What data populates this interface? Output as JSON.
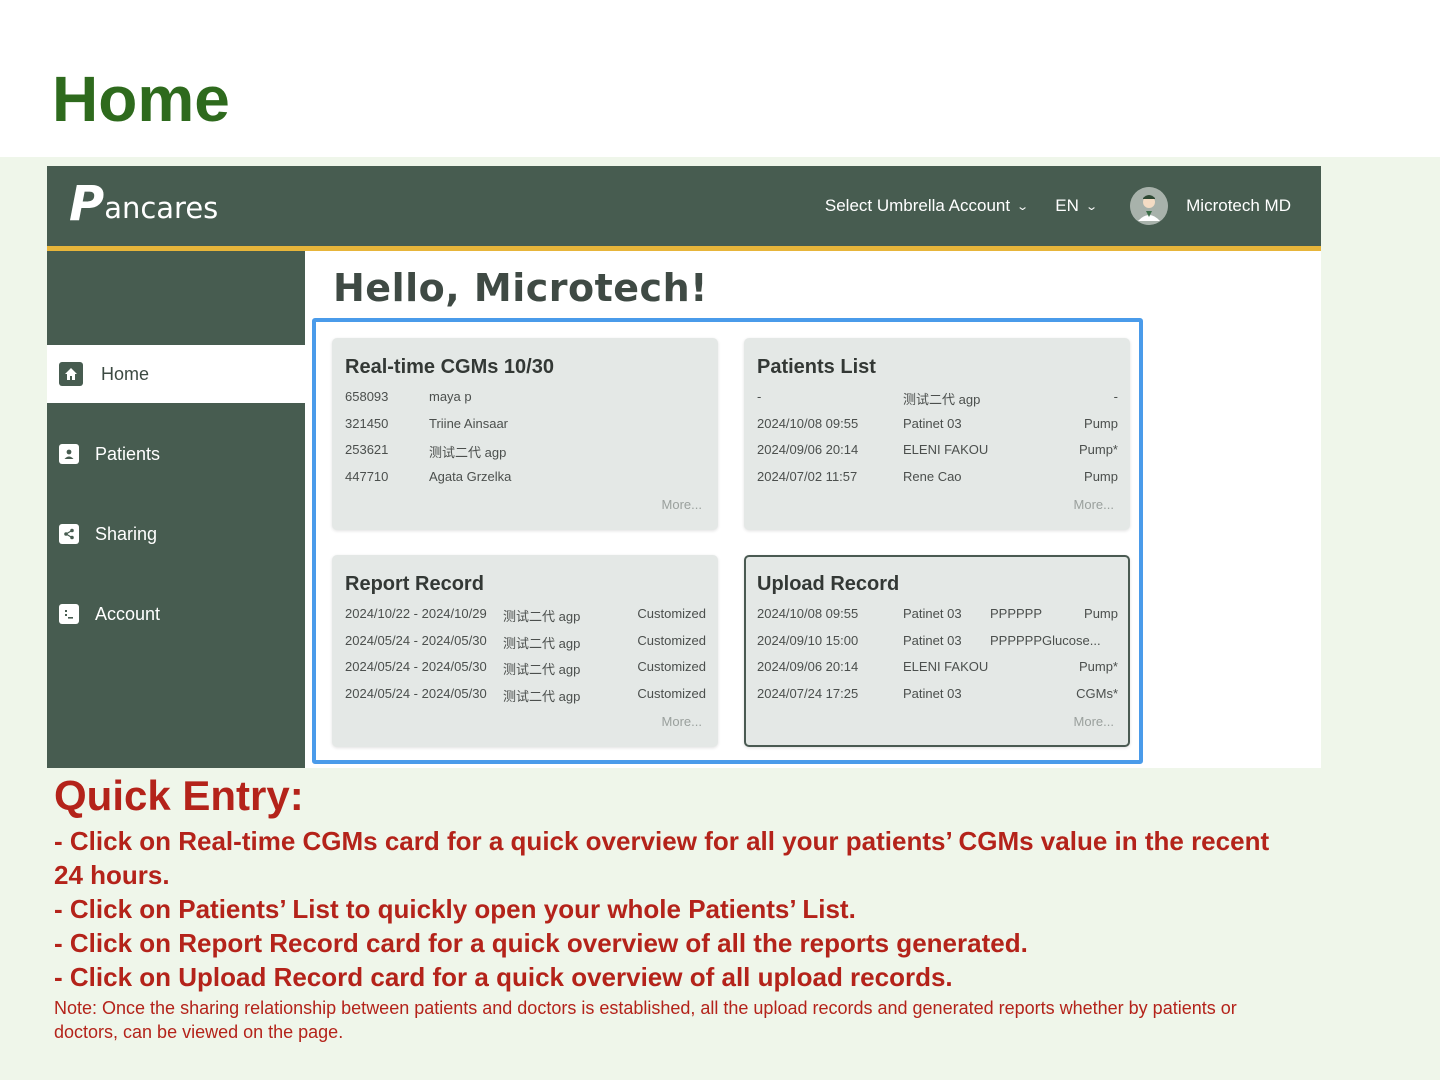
{
  "slide": {
    "title": "Home"
  },
  "app": {
    "logo_p": "P",
    "logo_rest": "ancares",
    "umbrella_label": "Select Umbrella Account",
    "language": "EN",
    "user_name": "Microtech MD",
    "greeting": "Hello, Microtech!",
    "sidebar": [
      {
        "label": "Home",
        "icon": "home-icon",
        "active": true
      },
      {
        "label": "Patients",
        "icon": "patient-icon",
        "active": false
      },
      {
        "label": "Sharing",
        "icon": "share-icon",
        "active": false
      },
      {
        "label": "Account",
        "icon": "account-icon",
        "active": false
      }
    ],
    "cards": {
      "cgm": {
        "title": "Real-time CGMs 10/30",
        "rows": [
          {
            "id": "658093",
            "name": "maya p"
          },
          {
            "id": "321450",
            "name": "Triine Ainsaar"
          },
          {
            "id": "253621",
            "name": "测试二代 agp"
          },
          {
            "id": "447710",
            "name": "Agata Grzelka"
          }
        ],
        "more": "More..."
      },
      "patients": {
        "title": "Patients List",
        "rows": [
          {
            "date": "-",
            "name": "测试二代 agp",
            "type": "-"
          },
          {
            "date": "2024/10/08 09:55",
            "name": "Patinet 03",
            "type": "Pump"
          },
          {
            "date": "2024/09/06 20:14",
            "name": "ELENI FAKOU",
            "type": "Pump*"
          },
          {
            "date": "2024/07/02 11:57",
            "name": "Rene Cao",
            "type": "Pump"
          }
        ],
        "more": "More..."
      },
      "report": {
        "title": "Report Record",
        "rows": [
          {
            "range": "2024/10/22 - 2024/10/29",
            "name": "测试二代 agp",
            "kind": "Customized"
          },
          {
            "range": "2024/05/24 - 2024/05/30",
            "name": "测试二代 agp",
            "kind": "Customized"
          },
          {
            "range": "2024/05/24 - 2024/05/30",
            "name": "测试二代 agp",
            "kind": "Customized"
          },
          {
            "range": "2024/05/24 - 2024/05/30",
            "name": "测试二代 agp",
            "kind": "Customized"
          }
        ],
        "more": "More..."
      },
      "upload": {
        "title": "Upload Record",
        "rows": [
          {
            "date": "2024/10/08 09:55",
            "name": "Patinet 03",
            "file": "PPPPPP",
            "type": "Pump"
          },
          {
            "date": "2024/09/10 15:00",
            "name": "Patinet 03",
            "file": "PPPPPPGlucose...",
            "type": ""
          },
          {
            "date": "2024/09/06 20:14",
            "name": "ELENI FAKOU",
            "file": "",
            "type": "Pump*"
          },
          {
            "date": "2024/07/24 17:25",
            "name": "Patinet 03",
            "file": "",
            "type": "CGMs*"
          }
        ],
        "more": "More..."
      }
    }
  },
  "caption": {
    "heading": "Quick Entry:",
    "lines": [
      "- Click on Real-time CGMs card for a quick overview for all your patients’ CGMs value in the recent 24 hours.",
      "- Click on Patients’ List to quickly open your whole Patients’ List.",
      "- Click on Report Record card for a quick overview of all the reports generated.",
      "- Click on Upload Record card for a quick overview of all upload records."
    ],
    "note": "Note: Once the sharing relationship between patients and doctors is established, all the upload records and generated reports  whether by patients or doctors, can be viewed on the page."
  },
  "colors": {
    "title_green": "#2e6a1d",
    "app_header": "#475c50",
    "accent_yellow": "#e7b53a",
    "highlight_blue": "#4a9bea",
    "caption_red": "#b4231a"
  }
}
